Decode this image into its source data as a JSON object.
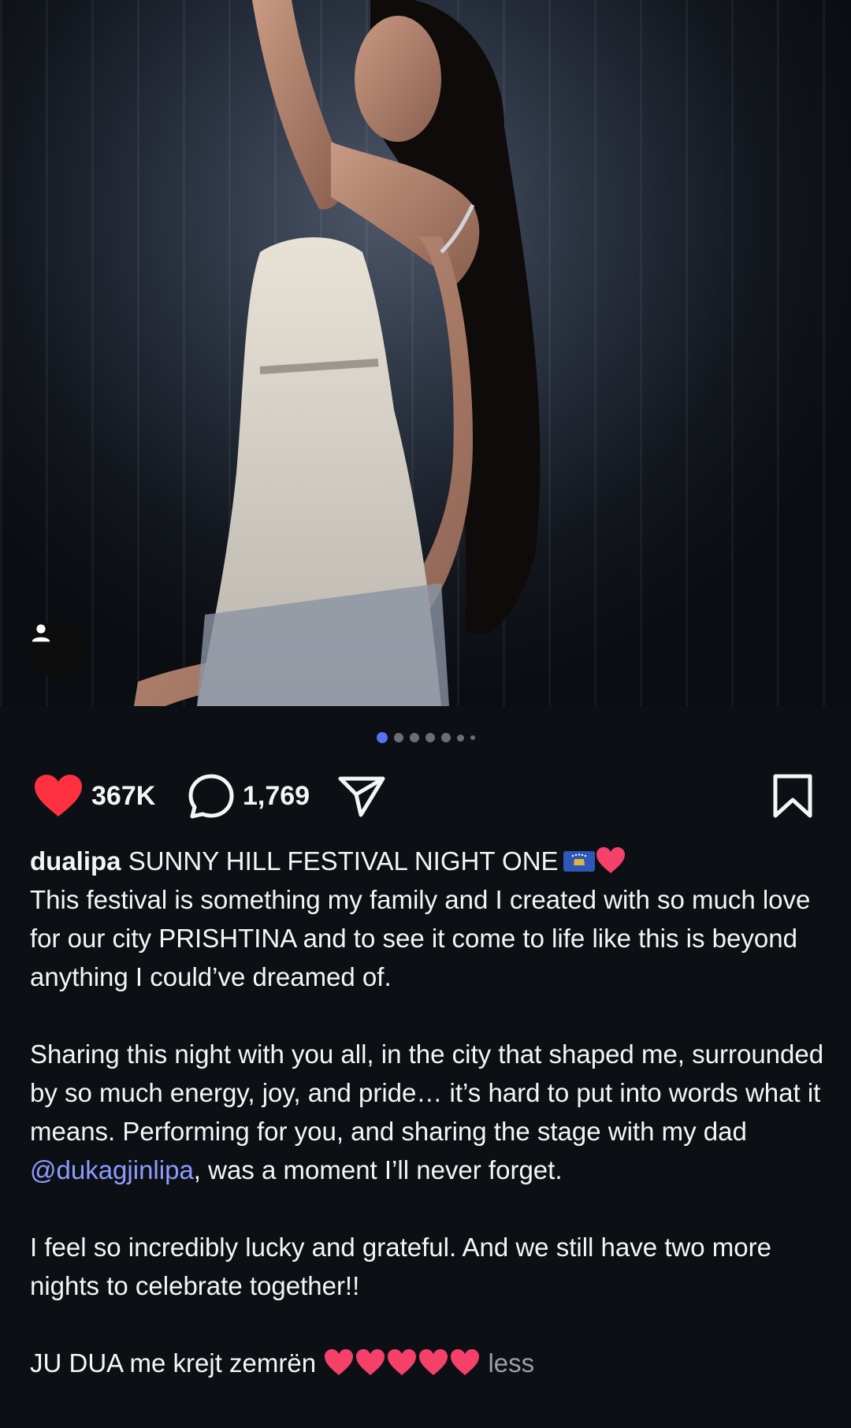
{
  "post": {
    "likes": "367K",
    "comments": "1,769",
    "carousel": {
      "total": 7,
      "active_index": 0
    }
  },
  "caption": {
    "username": "dualipa",
    "title": "SUNNY HILL FESTIVAL NIGHT ONE",
    "paragraph1": "This festival is something my family and I created with so much love for our city PRISHTINA and to see it come to life like this is beyond anything I could’ve dreamed of.",
    "paragraph2_before": "Sharing this night with you all, in the city that shaped me, surrounded by so much energy, joy, and pride… it’s hard to put into words what it means. Performing for you, and sharing the stage with my dad ",
    "mention": "@dukagjinlipa",
    "paragraph2_after": ", was a moment I’ll never forget.",
    "paragraph3": "I feel so incredibly lucky and grateful. And we still have two more nights to celebrate together!!",
    "paragraph4": "JU DUA me krejt zemrën",
    "less_label": "less"
  },
  "icons": {
    "like": "heart-icon",
    "comment": "comment-bubble-icon",
    "share": "paper-plane-icon",
    "save": "bookmark-icon",
    "tag": "person-tag-icon"
  },
  "colors": {
    "like_red": "#ff3040",
    "mention_blue": "#8e9bff",
    "carousel_active": "#5b6ff4",
    "background": "#0c1014"
  }
}
